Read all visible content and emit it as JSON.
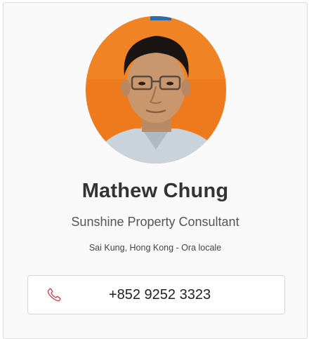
{
  "profile": {
    "name": "Mathew Chung",
    "title": "Sunshine Property Consultant",
    "location": "Sai Kung, Hong Kong - Ora locale",
    "avatar_alt": "avatar-photo"
  },
  "contact": {
    "phone_icon": "phone-icon",
    "phone_number": "+852 9252 3323",
    "accent_color": "#d9363e"
  }
}
